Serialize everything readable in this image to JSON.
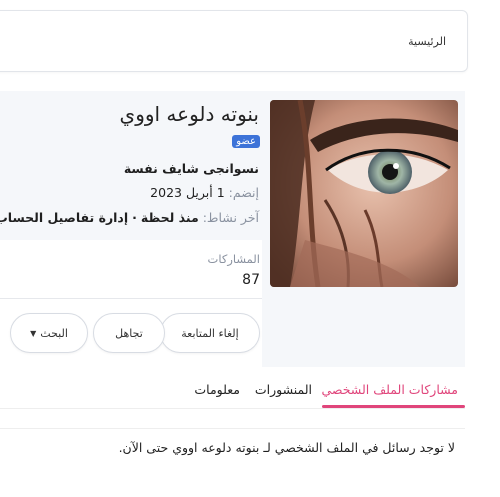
{
  "breadcrumb": {
    "home_label": "الرئيسية"
  },
  "profile": {
    "username": "بنوته دلوعه اووي",
    "badge": "عضو",
    "custom_title": "نسوانجى شايف نفسة",
    "joined_label": "إنضم:",
    "joined_value": "1 أبريل 2023",
    "active_label": "آخر نشاط:",
    "active_value": "منذ لحظة",
    "separator": "·",
    "manage_link": "إدارة تفاصيل الحساب"
  },
  "stats": {
    "posts_label": "المشاركات",
    "posts_value": "87"
  },
  "actions": {
    "unfollow_label": "إلغاء المتابعة",
    "ignore_label": "تجاهل",
    "search_label": "البحث"
  },
  "tabs": [
    {
      "label": "مشاركات الملف الشخصي",
      "active": true
    },
    {
      "label": "المنشورات",
      "active": false
    },
    {
      "label": "معلومات",
      "active": false
    }
  ],
  "content": {
    "empty_message": "لا توجد رسائل في الملف الشخصي لـ بنوته دلوعه اووي حتى الآن."
  },
  "colors": {
    "accent": "#e0457b",
    "badge": "#3d73d8"
  },
  "icons": {
    "search_dropdown": "caret-down-icon"
  }
}
